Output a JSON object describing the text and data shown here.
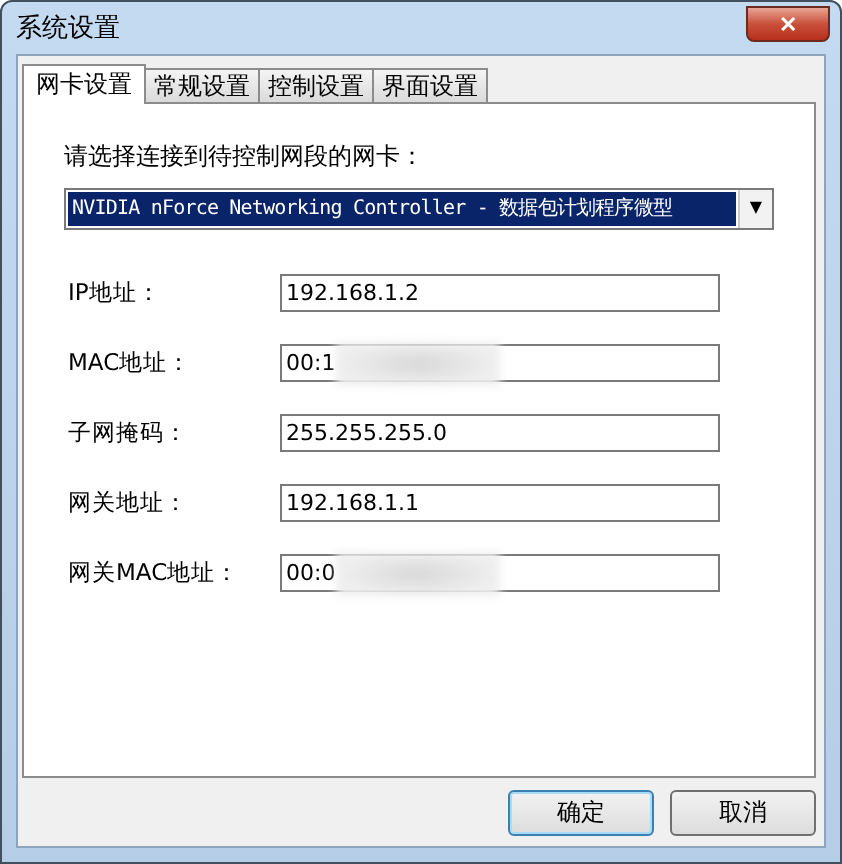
{
  "window": {
    "title": "系统设置",
    "close": "✕"
  },
  "tabs": [
    {
      "label": "网卡设置",
      "selected": true
    },
    {
      "label": "常规设置",
      "selected": false
    },
    {
      "label": "控制设置",
      "selected": false
    },
    {
      "label": "界面设置",
      "selected": false
    }
  ],
  "adapter": {
    "label": "请选择连接到待控制网段的网卡：",
    "value": "NVIDIA nForce Networking Controller - 数据包计划程序微型",
    "arrow": "▼"
  },
  "fields": [
    {
      "label": "IP地址：",
      "value": "192.168.1.2",
      "redacted": false
    },
    {
      "label": "MAC地址：",
      "value": "00:1",
      "redacted": true
    },
    {
      "label": "子网掩码：",
      "value": "255.255.255.0",
      "redacted": false
    },
    {
      "label": "网关地址：",
      "value": "192.168.1.1",
      "redacted": false
    },
    {
      "label": "网关MAC地址：",
      "value": "00:0",
      "redacted": true
    }
  ],
  "buttons": [
    {
      "label": "确定",
      "default": true
    },
    {
      "label": "取消",
      "default": false
    }
  ]
}
